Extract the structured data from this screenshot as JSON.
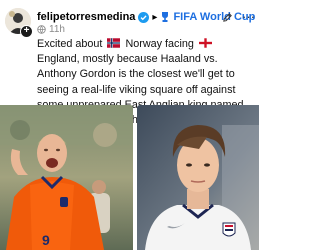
{
  "post": {
    "author": {
      "username": "felipetorresmedina",
      "avatar_icon": "avatar-icon",
      "verified_icon": "verified-badge-icon",
      "add_badge": "+"
    },
    "community": {
      "icon": "world-cup-trophy-icon",
      "name": "FIFA World Cup",
      "accent_color": "#1e6fe0"
    },
    "timestamp": "11h",
    "visibility_icon": "globe-icon",
    "text": {
      "part1": "Excited about",
      "flag1_icon": "norway-flag-icon",
      "part2": "Norway facing",
      "flag2_icon": "england-flag-icon",
      "part3": "England, mostly because Haaland vs. Anthony Gordon is the closest we'll get to seeing a real-life viking square off against some unprepared East Anglian king named something like Ceotheldred, The Meek."
    },
    "actions": {
      "edit_icon": "pencil-icon",
      "more_icon": "more-dots-icon",
      "more_label": "···"
    },
    "images": [
      {
        "subject": "player-orange-kit",
        "jersey_number": "9"
      },
      {
        "subject": "player-white-kit"
      }
    ]
  }
}
